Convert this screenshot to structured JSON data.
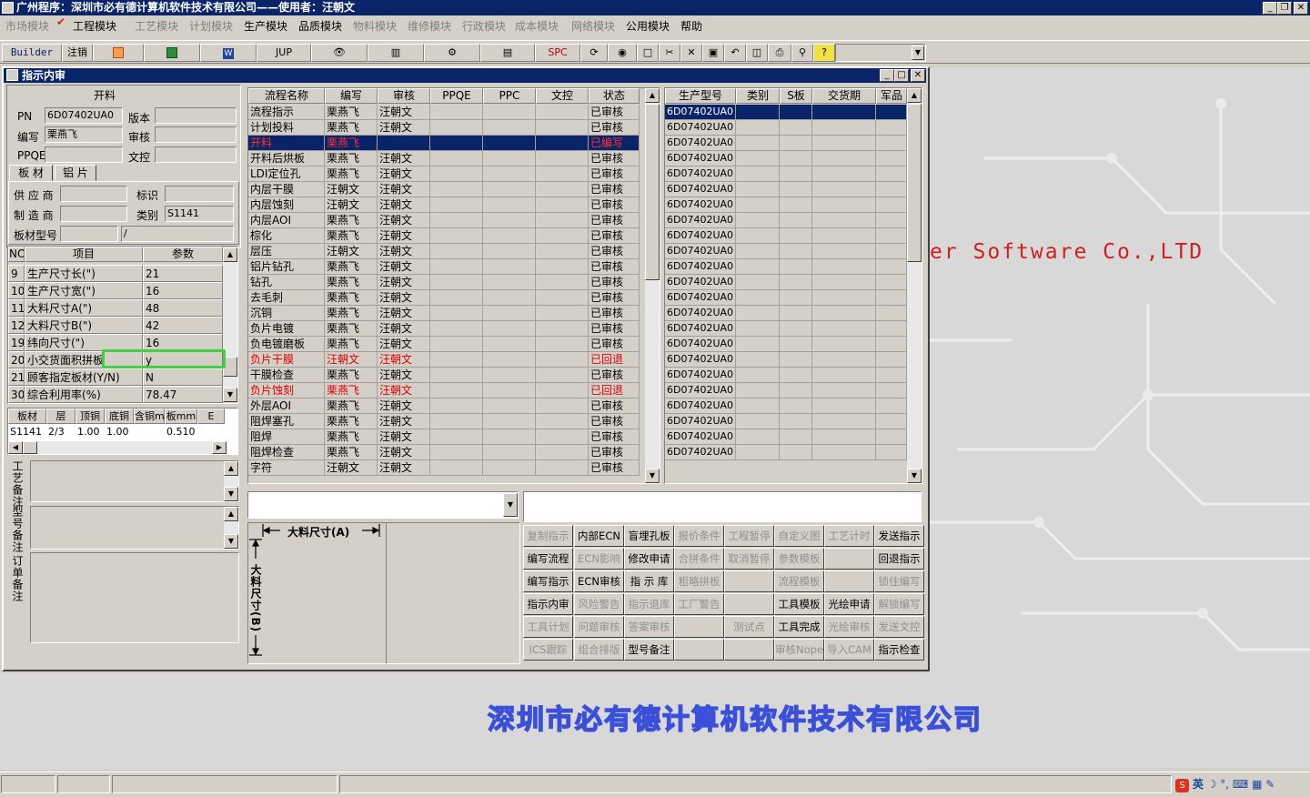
{
  "app": {
    "title": "广州程序：深圳市必有德计算机软件技术有限公司——使用者：汪朝文"
  },
  "menu": [
    {
      "label": "市场模块",
      "enabled": false
    },
    {
      "label": "工程模块",
      "enabled": true
    },
    {
      "label": "工艺模块",
      "enabled": false
    },
    {
      "label": "计划模块",
      "enabled": false
    },
    {
      "label": "生产模块",
      "enabled": true
    },
    {
      "label": "品质模块",
      "enabled": true
    },
    {
      "label": "物料模块",
      "enabled": false
    },
    {
      "label": "维修模块",
      "enabled": false
    },
    {
      "label": "行政模块",
      "enabled": false
    },
    {
      "label": "成本模块",
      "enabled": false
    },
    {
      "label": "网络模块",
      "enabled": false
    },
    {
      "label": "公用模块",
      "enabled": true
    },
    {
      "label": "帮助",
      "enabled": true
    }
  ],
  "toolbar": {
    "builder": "Builder",
    "logout": "注销",
    "jup": "JUP",
    "spc": "SPC"
  },
  "desktop": {
    "brand_text": "er Software Co.,LTD",
    "company": "深圳市必有德计算机软件技术有限公司"
  },
  "window": {
    "title": "指示内审"
  },
  "left": {
    "group_title": "开料",
    "pn_label": "PN",
    "pn_value": "6D07402UA0",
    "version_label": "版本",
    "version_value": "",
    "writer_label": "编写",
    "writer_value": "栗燕飞",
    "review_label": "审核",
    "review_value": "",
    "ppqe_label": "PPQE",
    "ppqe_value": "",
    "wenkong_label": "文控",
    "wenkong_value": "",
    "tabs": [
      "板 材",
      "铝 片"
    ],
    "supplier_label": "供 应 商",
    "supplier_value": "",
    "mark_label": "标识",
    "mark_value": "",
    "maker_label": "制 造 商",
    "maker_value": "",
    "category_label": "类别",
    "category_value": "S1141",
    "board_model_label": "板材型号",
    "board_model_value": "",
    "board_model_value2": "/",
    "param_headers": [
      "NO",
      "项目",
      "参数"
    ],
    "params": [
      {
        "no": "9",
        "item": "生产尺寸长(\")",
        "value": "21"
      },
      {
        "no": "10",
        "item": "生产尺寸宽(\")",
        "value": "16"
      },
      {
        "no": "11",
        "item": "大料尺寸A(\")",
        "value": "48"
      },
      {
        "no": "12",
        "item": "大料尺寸B(\")",
        "value": "42"
      },
      {
        "no": "19",
        "item": "纬向尺寸(\")",
        "value": "16"
      },
      {
        "no": "20",
        "item": "小交货面积拼板",
        "value": "y"
      },
      {
        "no": "21",
        "item": "顾客指定板材(Y/N)",
        "value": "N"
      },
      {
        "no": "30",
        "item": "综合利用率(%)",
        "value": "78.47"
      }
    ],
    "board_headers": [
      "板材",
      "层",
      "顶铜",
      "底铜",
      "含铜mm",
      "板mm",
      "E"
    ],
    "board_row": [
      "S1141",
      "2/3",
      "1.00",
      "1.00",
      "",
      "0.510",
      ""
    ],
    "notes": [
      "工艺备注",
      "型号备注",
      "订单备注"
    ]
  },
  "flow": {
    "headers": [
      "流程名称",
      "编写",
      "审核",
      "PPQE",
      "PPC",
      "文控",
      "状态"
    ],
    "rows": [
      {
        "name": "流程指示",
        "writer": "栗燕飞",
        "reviewer": "汪朝文",
        "status": "已审核",
        "style": "normal"
      },
      {
        "name": "计划投料",
        "writer": "栗燕飞",
        "reviewer": "汪朝文",
        "status": "已审核",
        "style": "normal"
      },
      {
        "name": "开料",
        "writer": "栗燕飞",
        "reviewer": "",
        "status": "已编写",
        "style": "selected"
      },
      {
        "name": "开料后烘板",
        "writer": "栗燕飞",
        "reviewer": "汪朝文",
        "status": "已审核",
        "style": "normal"
      },
      {
        "name": "LDI定位孔",
        "writer": "栗燕飞",
        "reviewer": "汪朝文",
        "status": "已审核",
        "style": "normal"
      },
      {
        "name": "内层干膜",
        "writer": "汪朝文",
        "reviewer": "汪朝文",
        "status": "已审核",
        "style": "normal"
      },
      {
        "name": "内层蚀刻",
        "writer": "汪朝文",
        "reviewer": "汪朝文",
        "status": "已审核",
        "style": "normal"
      },
      {
        "name": "内层AOI",
        "writer": "栗燕飞",
        "reviewer": "汪朝文",
        "status": "已审核",
        "style": "normal"
      },
      {
        "name": "棕化",
        "writer": "栗燕飞",
        "reviewer": "汪朝文",
        "status": "已审核",
        "style": "normal"
      },
      {
        "name": "层压",
        "writer": "汪朝文",
        "reviewer": "汪朝文",
        "status": "已审核",
        "style": "normal"
      },
      {
        "name": "铝片钻孔",
        "writer": "栗燕飞",
        "reviewer": "汪朝文",
        "status": "已审核",
        "style": "normal"
      },
      {
        "name": "钻孔",
        "writer": "栗燕飞",
        "reviewer": "汪朝文",
        "status": "已审核",
        "style": "normal"
      },
      {
        "name": "去毛刺",
        "writer": "栗燕飞",
        "reviewer": "汪朝文",
        "status": "已审核",
        "style": "normal"
      },
      {
        "name": "沉铜",
        "writer": "栗燕飞",
        "reviewer": "汪朝文",
        "status": "已审核",
        "style": "normal"
      },
      {
        "name": "负片电镀",
        "writer": "栗燕飞",
        "reviewer": "汪朝文",
        "status": "已审核",
        "style": "normal"
      },
      {
        "name": "负电镀磨板",
        "writer": "栗燕飞",
        "reviewer": "汪朝文",
        "status": "已审核",
        "style": "normal"
      },
      {
        "name": "负片干膜",
        "writer": "汪朝文",
        "reviewer": "汪朝文",
        "status": "已回退",
        "style": "red"
      },
      {
        "name": "干膜检查",
        "writer": "栗燕飞",
        "reviewer": "汪朝文",
        "status": "已审核",
        "style": "normal"
      },
      {
        "name": "负片蚀刻",
        "writer": "栗燕飞",
        "reviewer": "汪朝文",
        "status": "已回退",
        "style": "red"
      },
      {
        "name": "外层AOI",
        "writer": "栗燕飞",
        "reviewer": "汪朝文",
        "status": "已审核",
        "style": "normal"
      },
      {
        "name": "阻焊塞孔",
        "writer": "栗燕飞",
        "reviewer": "汪朝文",
        "status": "已审核",
        "style": "normal"
      },
      {
        "name": "阻焊",
        "writer": "栗燕飞",
        "reviewer": "汪朝文",
        "status": "已审核",
        "style": "normal"
      },
      {
        "name": "阻焊检查",
        "writer": "栗燕飞",
        "reviewer": "汪朝文",
        "status": "已审核",
        "style": "normal"
      },
      {
        "name": "字符",
        "writer": "汪朝文",
        "reviewer": "汪朝文",
        "status": "已审核",
        "style": "normal"
      }
    ]
  },
  "models": {
    "headers": [
      "生产型号",
      "类别",
      "S板",
      "交货期",
      "军品"
    ],
    "rows": [
      "6D07402UA0",
      "6D07402UA0",
      "6D07402UA0",
      "6D07402UA0",
      "6D07402UA0",
      "6D07402UA0",
      "6D07402UA0",
      "6D07402UA0",
      "6D07402UA0",
      "6D07402UA0",
      "6D07402UA0",
      "6D07402UA0",
      "6D07402UA0",
      "6D07402UA0",
      "6D07402UA0",
      "6D07402UA0",
      "6D07402UA0",
      "6D07402UA0",
      "6D07402UA0",
      "6D07402UA0",
      "6D07402UA0",
      "6D07402UA0",
      "6D07402UA0"
    ]
  },
  "diagram": {
    "a_label": "大料尺寸(A)",
    "b_label": "大料尺寸(B)"
  },
  "actions": [
    [
      "复制指示",
      "内部ECN",
      "盲埋孔板",
      "报价条件",
      "工程暂停",
      "自定义图",
      "工艺计时",
      "发送指示"
    ],
    [
      "编写流程",
      "ECN影响",
      "修改申请",
      "合拼条件",
      "取消暂停",
      "参数模板",
      "",
      "回退指示"
    ],
    [
      "编写指示",
      "ECN审核",
      "指 示 库",
      "粗略拼板",
      "",
      "流程模板",
      "",
      "锁住编写"
    ],
    [
      "指示内审",
      "风险警告",
      "指示退库",
      "工厂警告",
      "",
      "工具模板",
      "光绘申请",
      "解锁编写"
    ],
    [
      "工具计划",
      "问题审核",
      "答案审核",
      "",
      "测试点",
      "工具完成",
      "光绘审核",
      "发送文控"
    ],
    [
      "ICS跟踪",
      "组合排版",
      "型号备注",
      "",
      "",
      "审核Nope",
      "导入CAM",
      "指示检查"
    ]
  ],
  "actions_disabled": [
    [
      true,
      false,
      false,
      true,
      true,
      true,
      true,
      false
    ],
    [
      false,
      true,
      false,
      true,
      true,
      true,
      false,
      false
    ],
    [
      false,
      false,
      false,
      true,
      false,
      true,
      false,
      true
    ],
    [
      false,
      true,
      true,
      true,
      false,
      false,
      false,
      true
    ],
    [
      true,
      true,
      true,
      false,
      true,
      false,
      true,
      true
    ],
    [
      true,
      true,
      false,
      false,
      false,
      true,
      true,
      false
    ]
  ],
  "tray": {
    "ime": "英"
  }
}
